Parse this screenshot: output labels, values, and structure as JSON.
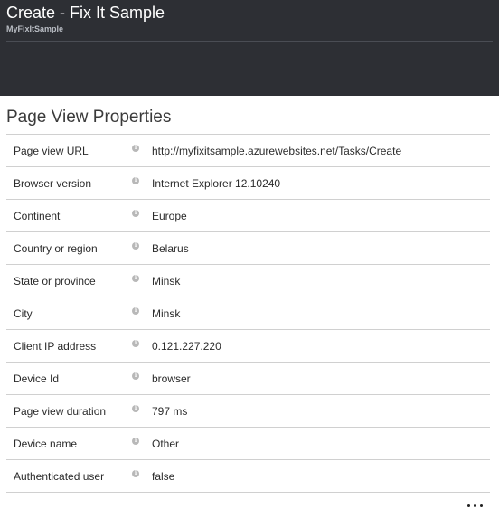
{
  "header": {
    "title": "Create - Fix It Sample",
    "subtitle": "MyFixItSample",
    "background_color": "#2d2f34"
  },
  "section": {
    "title": "Page View Properties"
  },
  "properties": [
    {
      "label": "Page view URL",
      "value": "http://myfixitsample.azurewebsites.net/Tasks/Create"
    },
    {
      "label": "Browser version",
      "value": "Internet Explorer 12.10240"
    },
    {
      "label": "Continent",
      "value": "Europe"
    },
    {
      "label": "Country or region",
      "value": "Belarus"
    },
    {
      "label": "State or province",
      "value": "Minsk"
    },
    {
      "label": "City",
      "value": "Minsk"
    },
    {
      "label": "Client IP address",
      "value": "0.121.227.220"
    },
    {
      "label": "Device Id",
      "value": "browser"
    },
    {
      "label": "Page view duration",
      "value": "797 ms"
    },
    {
      "label": "Device name",
      "value": "Other"
    },
    {
      "label": "Authenticated user",
      "value": "false"
    }
  ],
  "icons": {
    "info": "info-icon",
    "more": "more-icon"
  },
  "info_glyph": "i"
}
